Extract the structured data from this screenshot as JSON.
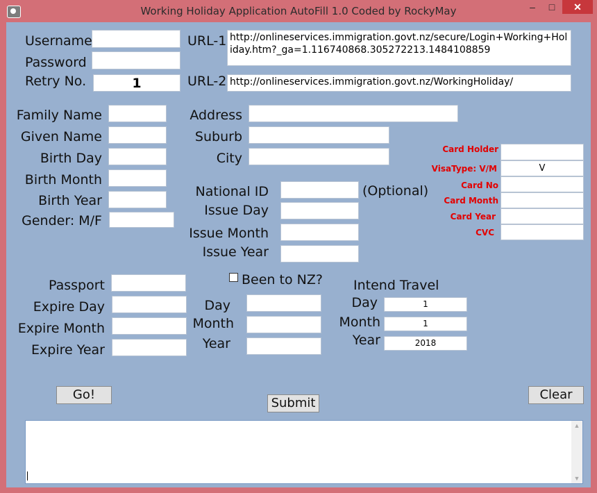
{
  "window": {
    "title": "Working Holiday Application AutoFill 1.0  Coded by RockyMay",
    "controls": {
      "minimize": "–",
      "maximize": "□",
      "close": "✕"
    }
  },
  "login": {
    "username_label": "Username",
    "username_value": "",
    "password_label": "Password",
    "password_value": "",
    "retry_label": "Retry No.",
    "retry_value": "1",
    "url1_label": "URL-1",
    "url1_value": "http://onlineservices.immigration.govt.nz/secure/Login+Working+Holiday.htm?_ga=1.116740868.305272213.1484108859",
    "url2_label": "URL-2",
    "url2_value": "http://onlineservices.immigration.govt.nz/WorkingHoliday/"
  },
  "personal": {
    "family_name_label": "Family Name",
    "given_name_label": "Given Name",
    "birth_day_label": "Birth Day",
    "birth_month_label": "Birth Month",
    "birth_year_label": "Birth Year",
    "gender_label": "Gender: M/F"
  },
  "address": {
    "address_label": "Address",
    "suburb_label": "Suburb",
    "city_label": "City"
  },
  "national_id": {
    "national_id_label": "National ID",
    "optional_label": "(Optional)",
    "issue_day_label": "Issue Day",
    "issue_month_label": "Issue Month",
    "issue_year_label": "Issue Year"
  },
  "card": {
    "holder_label": "Card Holder",
    "visa_type_label": "VisaType: V/M",
    "visa_type_value": "V",
    "card_no_label": "Card No",
    "card_month_label": "Card Month",
    "card_year_label": "Card Year",
    "cvc_label": "CVC",
    "label_color": "#e30000"
  },
  "passport": {
    "passport_label": "Passport",
    "expire_day_label": "Expire Day",
    "expire_month_label": "Expire Month",
    "expire_year_label": "Expire Year"
  },
  "been_to_nz": {
    "label": "Been to NZ?",
    "checked": false,
    "day_label": "Day",
    "month_label": "Month",
    "year_label": "Year"
  },
  "travel": {
    "heading": "Intend Travel",
    "day_label": "Day",
    "day_value": "1",
    "month_label": "Month",
    "month_value": "1",
    "year_label": "Year",
    "year_value": "2018"
  },
  "actions": {
    "go_label": "Go!",
    "submit_label": "Submit",
    "clear_label": "Clear"
  },
  "log": {
    "value": ""
  },
  "colors": {
    "titlebar": "#d36f77",
    "client": "#98b0cf",
    "close_button": "#c7373c"
  }
}
